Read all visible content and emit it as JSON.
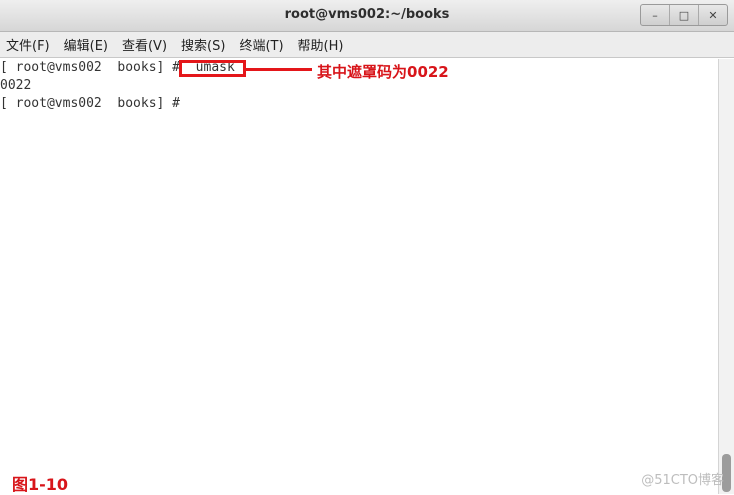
{
  "window": {
    "title": "root@vms002:~/books",
    "buttons": {
      "minimize": "–",
      "maximize": "□",
      "close": "✕"
    }
  },
  "menu": {
    "items": [
      "文件(F)",
      "编辑(E)",
      "查看(V)",
      "搜索(S)",
      "终端(T)",
      "帮助(H)"
    ]
  },
  "terminal": {
    "lines": [
      "[ root@vms002  books] #  umask",
      "0022",
      "[ root@vms002  books] #"
    ]
  },
  "annotation": {
    "callout": "其中遮罩码为0022",
    "figure_label": "图1-10",
    "color": "#e4161a"
  },
  "watermark": "@51CTO博客"
}
